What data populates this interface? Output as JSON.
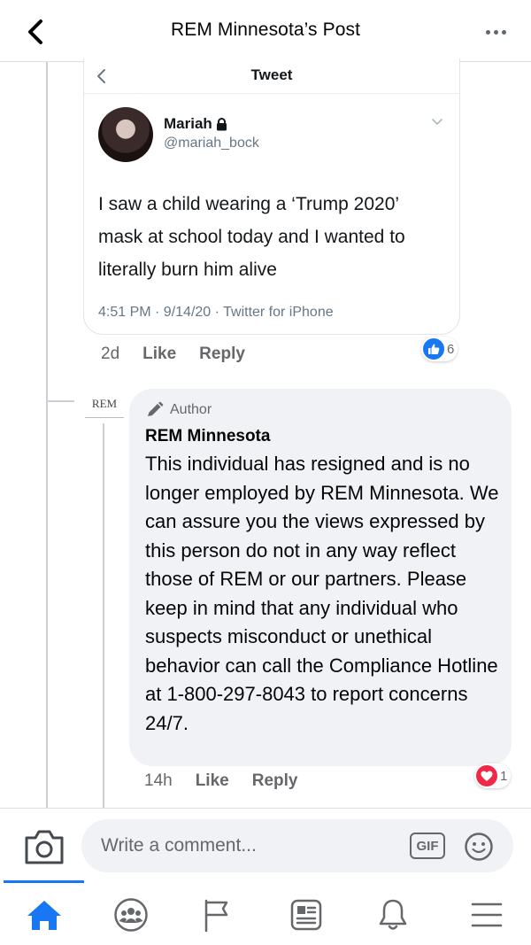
{
  "header": {
    "title": "REM Minnesota’s Post"
  },
  "tweet": {
    "header_title": "Tweet",
    "author_name": "Mariah",
    "handle": "@mariah_bock",
    "text": "I saw a child wearing a ‘Trump 2020’ mask at school today and I wanted to literally burn him alive",
    "meta": "4:51 PM · 9/14/20 · Twitter for iPhone"
  },
  "comment": {
    "time": "2d",
    "like_label": "Like",
    "reply_label": "Reply",
    "reaction_count": "6"
  },
  "reply": {
    "logo_text": "REM",
    "author_badge": "Author",
    "name": "REM Minnesota",
    "text": "This individual has resigned and is no longer employed by REM Minnesota. We can assure you the views expressed by this person do not in any way reflect those of REM or our partners. Please keep in mind that any individual who suspects misconduct or unethical behavior can call the Compliance Hotline at 1-800-297-8043 to report concerns 24/7.",
    "time": "14h",
    "like_label": "Like",
    "reply_label": "Reply",
    "reaction_count": "1"
  },
  "composer": {
    "placeholder": "Write a comment...",
    "gif_label": "GIF"
  },
  "tabs": [
    {
      "icon": "home-icon",
      "active": true
    },
    {
      "icon": "groups-icon",
      "active": false
    },
    {
      "icon": "pages-flag-icon",
      "active": false
    },
    {
      "icon": "news-feed-icon",
      "active": false
    },
    {
      "icon": "notifications-bell-icon",
      "active": false
    },
    {
      "icon": "menu-icon",
      "active": false
    }
  ],
  "colors": {
    "accent": "#1877f2",
    "love_red": "#f02849",
    "secondary_text": "#65676b"
  }
}
